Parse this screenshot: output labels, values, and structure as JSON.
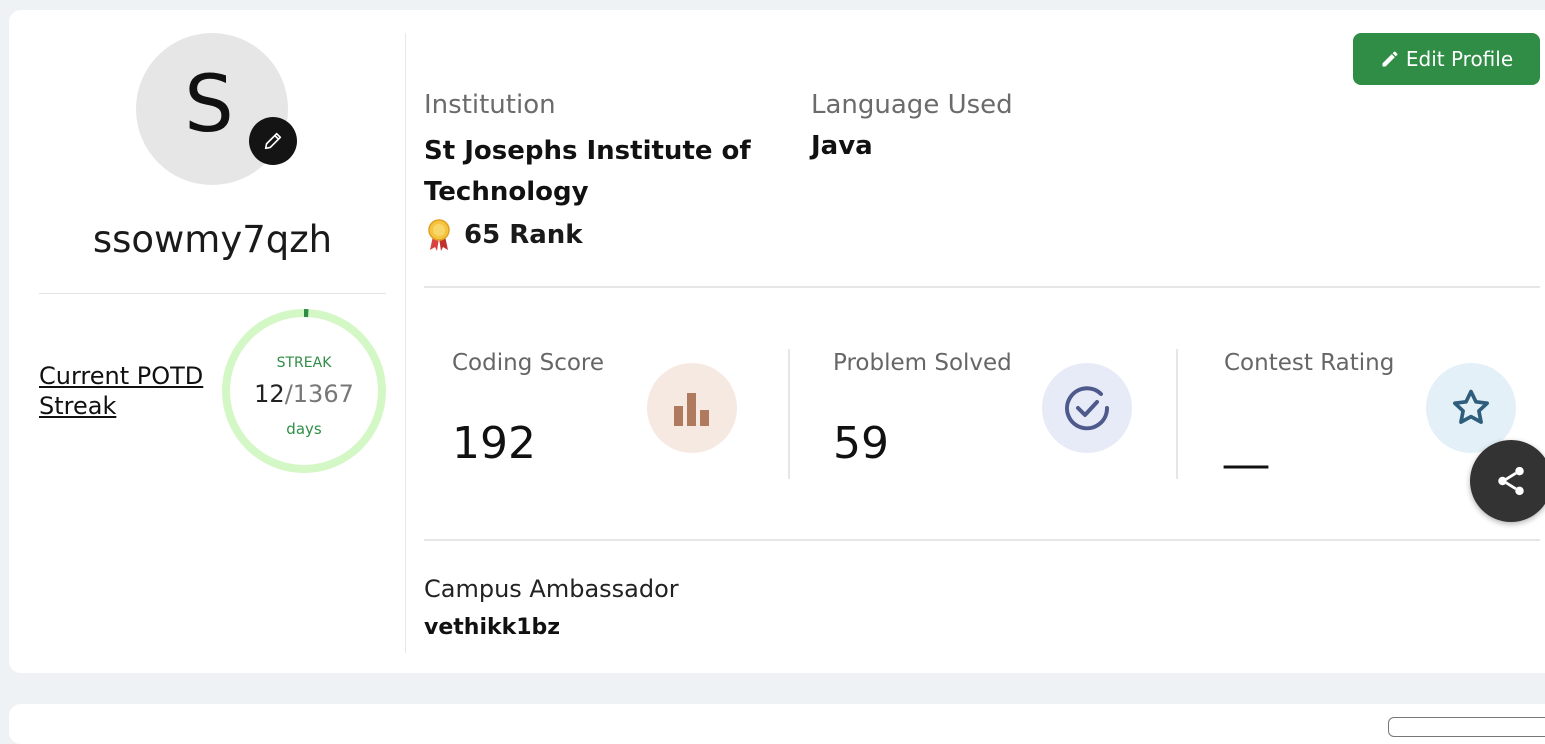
{
  "profile": {
    "avatar_letter": "S",
    "username": "ssowmy7qzh",
    "edit_button_label": "Edit Profile"
  },
  "streak": {
    "link_label": "Current POTD Streak",
    "label": "STREAK",
    "current": "12",
    "total": "/1367",
    "unit": "days",
    "progress_fraction": 0.0088
  },
  "info": {
    "institution_label": "Institution",
    "institution_value": "St Josephs Institute of Technology",
    "language_label": "Language Used",
    "language_value": "Java",
    "rank_text": "65 Rank"
  },
  "stats": [
    {
      "label": "Coding Score",
      "value": "192",
      "icon": "bar-chart-icon"
    },
    {
      "label": "Problem Solved",
      "value": "59",
      "icon": "check-circle-icon"
    },
    {
      "label": "Contest Rating",
      "value": "__",
      "icon": "star-icon"
    }
  ],
  "ambassador": {
    "label": "Campus Ambassador",
    "value": "vethikk1bz"
  },
  "colors": {
    "primary_green": "#2f8d46",
    "streak_ring": "#d4f7c6",
    "coding_icon_bg": "#f6e9e2",
    "problem_icon_bg": "#e7ebf7",
    "contest_icon_bg": "#e3f0f8"
  }
}
